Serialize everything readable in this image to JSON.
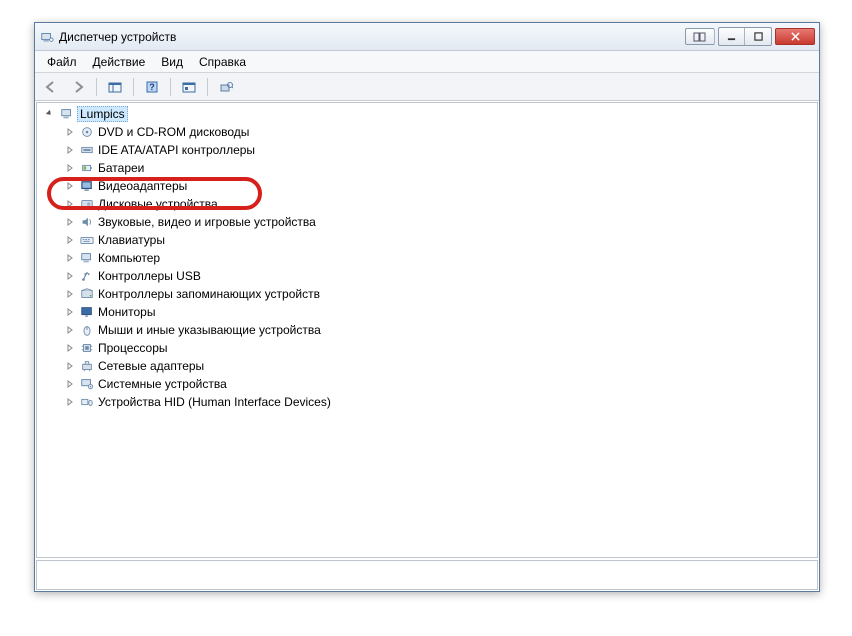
{
  "window": {
    "title": "Диспетчер устройств"
  },
  "menu": {
    "file": "Файл",
    "action": "Действие",
    "view": "Вид",
    "help": "Справка"
  },
  "tree": {
    "root": "Lumpics",
    "items": [
      {
        "label": "DVD и CD-ROM дисководы",
        "icon": "disc"
      },
      {
        "label": "IDE ATA/ATAPI контроллеры",
        "icon": "ide"
      },
      {
        "label": "Батареи",
        "icon": "battery"
      },
      {
        "label": "Видеоадаптеры",
        "icon": "display"
      },
      {
        "label": "Дисковые устройства",
        "icon": "disk"
      },
      {
        "label": "Звуковые, видео и игровые устройства",
        "icon": "sound"
      },
      {
        "label": "Клавиатуры",
        "icon": "keyboard"
      },
      {
        "label": "Компьютер",
        "icon": "computer"
      },
      {
        "label": "Контроллеры USB",
        "icon": "usb"
      },
      {
        "label": "Контроллеры запоминающих устройств",
        "icon": "storage"
      },
      {
        "label": "Мониторы",
        "icon": "monitor"
      },
      {
        "label": "Мыши и иные указывающие устройства",
        "icon": "mouse"
      },
      {
        "label": "Процессоры",
        "icon": "cpu"
      },
      {
        "label": "Сетевые адаптеры",
        "icon": "network"
      },
      {
        "label": "Системные устройства",
        "icon": "system"
      },
      {
        "label": "Устройства HID (Human Interface Devices)",
        "icon": "hid"
      }
    ]
  },
  "highlight_index": 3
}
